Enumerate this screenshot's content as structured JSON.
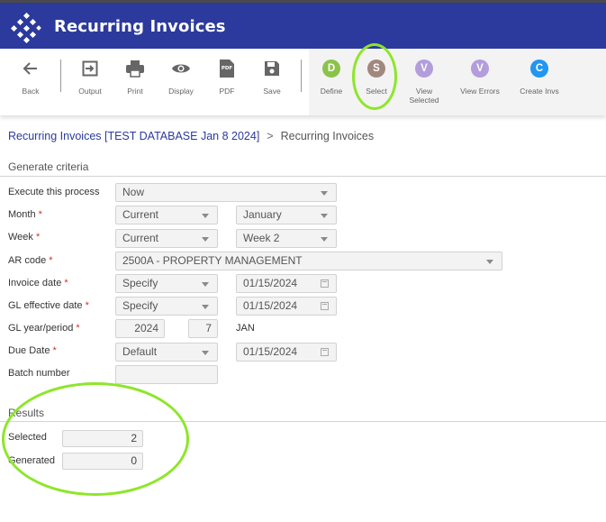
{
  "app": {
    "title": "Recurring Invoices"
  },
  "toolbar": {
    "back": "Back",
    "output": "Output",
    "print": "Print",
    "display": "Display",
    "pdf": "PDF",
    "save": "Save",
    "define": {
      "label": "Define",
      "letter": "D",
      "color": "#8bc34a"
    },
    "select": {
      "label": "Select",
      "letter": "S",
      "color": "#a1887f"
    },
    "view_selected": {
      "label1": "View",
      "label2": "Selected",
      "letter": "V",
      "color": "#b39ddb"
    },
    "view_errors": {
      "label": "View Errors",
      "letter": "V",
      "color": "#b39ddb"
    },
    "create_invs": {
      "label": "Create Invs",
      "letter": "C",
      "color": "#2196f3"
    },
    "pdf_badge": "PDF"
  },
  "breadcrumb": {
    "link": "Recurring Invoices [TEST DATABASE Jan 8 2024]",
    "sep": ">",
    "current": "Recurring Invoices"
  },
  "criteria": {
    "title": "Generate criteria",
    "execute_label": "Execute this process",
    "execute_value": "Now",
    "month_label": "Month",
    "month_value": "Current",
    "month_name": "January",
    "week_label": "Week",
    "week_value": "Current",
    "week_name": "Week 2",
    "ar_label": "AR code",
    "ar_value": "2500A - PROPERTY MANAGEMENT",
    "invoice_date_label": "Invoice date",
    "invoice_date_mode": "Specify",
    "invoice_date": "01/15/2024",
    "gl_eff_label": "GL effective date",
    "gl_eff_mode": "Specify",
    "gl_eff_date": "01/15/2024",
    "gl_year_label": "GL year/period",
    "gl_year": "2024",
    "gl_period": "7",
    "gl_month": "JAN",
    "due_label": "Due Date",
    "due_mode": "Default",
    "due_date": "01/15/2024",
    "batch_label": "Batch number",
    "batch_value": "",
    "required_mark": "*"
  },
  "results": {
    "title": "Results",
    "selected_label": "Selected",
    "selected_value": "2",
    "generated_label": "Generated",
    "generated_value": "0"
  },
  "colors": {
    "header": "#2b3a9c",
    "highlight": "#8ee62a"
  }
}
